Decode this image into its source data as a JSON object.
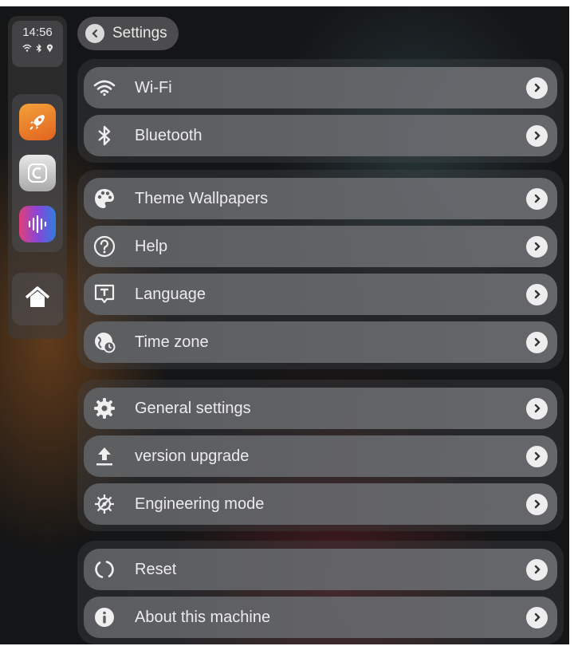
{
  "status": {
    "time": "14:56",
    "icons": [
      "wifi-icon",
      "bluetooth-icon",
      "location-icon"
    ]
  },
  "dock": {
    "apps": [
      {
        "name": "rocket-app-icon",
        "color": "#ee7f2a"
      },
      {
        "name": "carplay-app-icon",
        "color": "#c9c9c9"
      },
      {
        "name": "music-app-icon",
        "color": "#8a45d6"
      }
    ],
    "home_icon": "home-icon"
  },
  "header": {
    "back_label": "Settings"
  },
  "groups": [
    {
      "items": [
        {
          "label": "Wi-Fi",
          "icon": "wifi-icon"
        },
        {
          "label": "Bluetooth",
          "icon": "bluetooth-icon"
        }
      ]
    },
    {
      "items": [
        {
          "label": "Theme Wallpapers",
          "icon": "palette-icon"
        },
        {
          "label": "Help",
          "icon": "help-icon"
        },
        {
          "label": "Language",
          "icon": "language-icon"
        },
        {
          "label": "Time zone",
          "icon": "globe-clock-icon"
        }
      ]
    },
    {
      "items": [
        {
          "label": "General settings",
          "icon": "gear-icon"
        },
        {
          "label": "version upgrade",
          "icon": "upload-icon"
        },
        {
          "label": "Engineering mode",
          "icon": "engineering-gear-icon"
        }
      ]
    },
    {
      "items": [
        {
          "label": "Reset",
          "icon": "reset-icon"
        },
        {
          "label": "About this machine",
          "icon": "info-icon"
        }
      ]
    }
  ],
  "colors": {
    "row_bg": "#616366",
    "text": "#ececec",
    "chevron_bg": "#eeeeee"
  }
}
